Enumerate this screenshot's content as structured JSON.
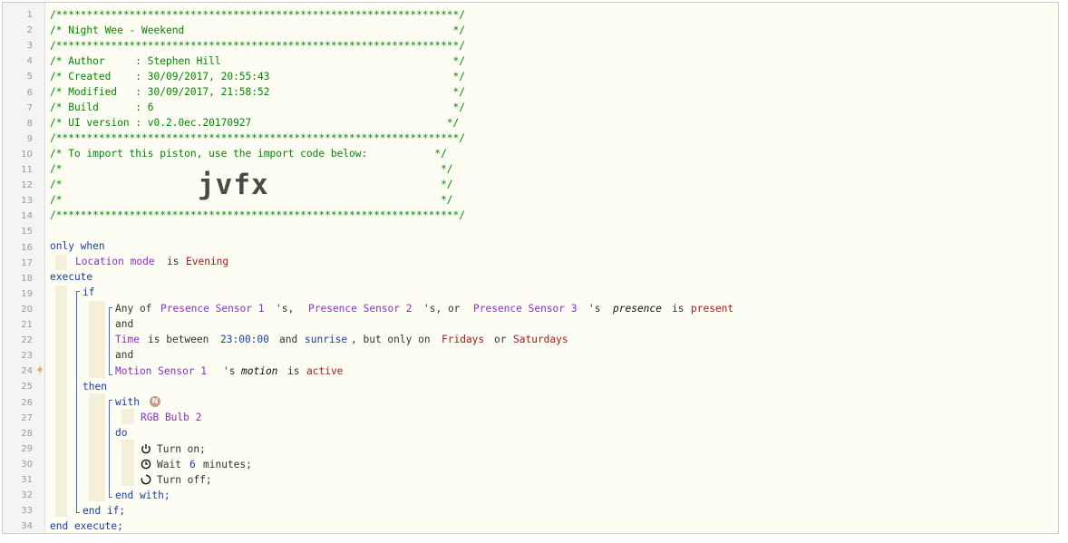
{
  "editor": {
    "line_numbers": [
      "1",
      "2",
      "3",
      "4",
      "5",
      "6",
      "7",
      "8",
      "9",
      "10",
      "11",
      "12",
      "13",
      "14",
      "15",
      "16",
      "17",
      "18",
      "19",
      "20",
      "21",
      "22",
      "23",
      "24",
      "25",
      "26",
      "27",
      "28",
      "29",
      "30",
      "31",
      "32",
      "33",
      "34"
    ],
    "header": {
      "stars": "/******************************************************************/",
      "title": "/* Night Wee - Weekend                                            */",
      "author": "/* Author     : Stephen Hill                                      */",
      "created": "/* Created    : 30/09/2017, 20:55:43                              */",
      "modified": "/* Modified   : 30/09/2017, 21:58:52                              */",
      "build": "/* Build      : 6                                                 */",
      "ui_version": "/* UI version : v0.2.0ec.20170927                                */",
      "import_note": "/* To import this piston, use the import code below:           */",
      "blank": "/*                                                              */",
      "import_code": "jvfx"
    },
    "code": {
      "only_when": "only when",
      "location_mode": "Location mode",
      "is": "is",
      "evening": "Evening",
      "execute": "execute",
      "if": "if",
      "any_of": "Any of",
      "presence_sensor_1": "Presence Sensor 1",
      "s_comma": "'s,",
      "presence_sensor_2": "Presence Sensor 2",
      "s_comma_or": "'s, or",
      "presence_sensor_3": "Presence Sensor 3",
      "s": "'s",
      "presence": "presence",
      "present": "present",
      "and": "and",
      "time": "Time",
      "is_between": "is between",
      "time_value": "23:00:00",
      "and_word": "and",
      "sunrise": "sunrise",
      "but_only_on": ", but only on",
      "fridays": "Fridays",
      "or": "or",
      "saturdays": "Saturdays",
      "motion_sensor_1": "Motion Sensor 1",
      "motion": "motion",
      "active": "active",
      "then": "then",
      "with": "with",
      "badge": "N",
      "rgb_bulb_2": "RGB Bulb 2",
      "do": "do",
      "turn_on": "Turn on;",
      "wait": "Wait",
      "wait_value": "6",
      "minutes": "minutes;",
      "turn_off": "Turn off;",
      "end_with": "end with;",
      "end_if": "end if;",
      "end_execute": "end execute;"
    }
  }
}
